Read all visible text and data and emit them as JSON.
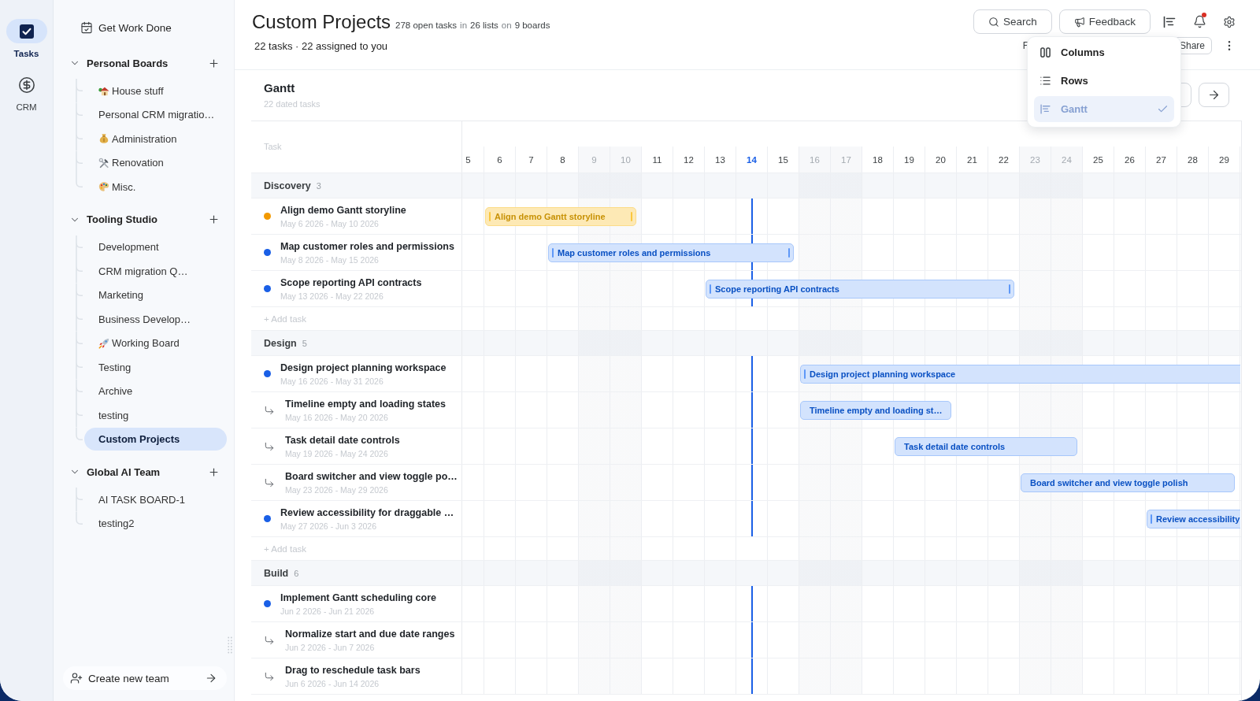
{
  "rail": [
    {
      "label": "Tasks",
      "kind": "tasks",
      "selected": true
    },
    {
      "label": "CRM",
      "kind": "crm",
      "selected": false
    }
  ],
  "sidebar": {
    "top_link": "Get Work Done",
    "sections": [
      {
        "title": "Personal Boards",
        "expanded": true,
        "items": [
          {
            "label": "House stuff",
            "kind": "house",
            "selected": false
          },
          {
            "label": "Personal CRM migratio…",
            "kind": "plain",
            "selected": false
          },
          {
            "label": "Administration",
            "kind": "moneybag",
            "selected": false
          },
          {
            "label": "Renovation",
            "kind": "tools",
            "selected": false
          },
          {
            "label": "Misc.",
            "kind": "palette",
            "selected": false
          }
        ]
      },
      {
        "title": "Tooling Studio",
        "expanded": true,
        "items": [
          {
            "label": "Development",
            "kind": "plain",
            "selected": false
          },
          {
            "label": "CRM migration Q…",
            "kind": "plain",
            "selected": false
          },
          {
            "label": "Marketing",
            "kind": "plain",
            "selected": false
          },
          {
            "label": "Business Develop…",
            "kind": "plain",
            "selected": false
          },
          {
            "label": "Working Board",
            "kind": "rocket",
            "selected": false
          },
          {
            "label": "Testing",
            "kind": "plain",
            "selected": false
          },
          {
            "label": "Archive",
            "kind": "plain",
            "selected": false
          },
          {
            "label": "testing",
            "kind": "plain",
            "selected": false
          },
          {
            "label": "Custom Projects",
            "kind": "plain",
            "selected": true
          }
        ]
      },
      {
        "title": "Global AI Team",
        "expanded": true,
        "items": [
          {
            "label": "AI TASK BOARD-1",
            "kind": "plain",
            "selected": false
          },
          {
            "label": "testing2",
            "kind": "plain",
            "selected": false
          }
        ]
      }
    ],
    "footer": "Create new team"
  },
  "header": {
    "title": "Custom Projects",
    "stats": [
      {
        "text": "278 open tasks",
        "kind": "value"
      },
      {
        "text": "in",
        "kind": "joiner"
      },
      {
        "text": "26 lists",
        "kind": "value"
      },
      {
        "text": "on",
        "kind": "joiner"
      },
      {
        "text": "9 boards",
        "kind": "value"
      }
    ],
    "subtitle": "22 tasks · 22 assigned to you",
    "buttons": [
      {
        "label": "Search",
        "kind": "search"
      },
      {
        "label": "Feedback",
        "kind": "feedback"
      }
    ],
    "notifications_unread": true,
    "covered_label": "F",
    "share_button": "Share"
  },
  "view_menu": [
    {
      "label": "Columns",
      "kind": "columns",
      "selected": false
    },
    {
      "label": "Rows",
      "kind": "rows",
      "selected": false
    },
    {
      "label": "Gantt",
      "kind": "gantt",
      "selected": true
    }
  ],
  "gantt": {
    "title": "Gantt",
    "subtitle": "22 dated tasks",
    "task_heading": "Task",
    "days": [
      {
        "label": "5",
        "weekend": false,
        "today": false
      },
      {
        "label": "6",
        "weekend": false,
        "today": false
      },
      {
        "label": "7",
        "weekend": false,
        "today": false
      },
      {
        "label": "8",
        "weekend": false,
        "today": false
      },
      {
        "label": "9",
        "weekend": true,
        "today": false
      },
      {
        "label": "10",
        "weekend": true,
        "today": false
      },
      {
        "label": "11",
        "weekend": false,
        "today": false
      },
      {
        "label": "12",
        "weekend": false,
        "today": false
      },
      {
        "label": "13",
        "weekend": false,
        "today": false
      },
      {
        "label": "14",
        "weekend": false,
        "today": true
      },
      {
        "label": "15",
        "weekend": false,
        "today": false
      },
      {
        "label": "16",
        "weekend": true,
        "today": false
      },
      {
        "label": "17",
        "weekend": true,
        "today": false
      },
      {
        "label": "18",
        "weekend": false,
        "today": false
      },
      {
        "label": "19",
        "weekend": false,
        "today": false
      },
      {
        "label": "20",
        "weekend": false,
        "today": false
      },
      {
        "label": "21",
        "weekend": false,
        "today": false
      },
      {
        "label": "22",
        "weekend": false,
        "today": false
      },
      {
        "label": "23",
        "weekend": true,
        "today": false
      },
      {
        "label": "24",
        "weekend": true,
        "today": false
      },
      {
        "label": "25",
        "weekend": false,
        "today": false
      },
      {
        "label": "26",
        "weekend": false,
        "today": false
      },
      {
        "label": "27",
        "weekend": false,
        "today": false
      },
      {
        "label": "28",
        "weekend": false,
        "today": false
      },
      {
        "label": "29",
        "weekend": false,
        "today": false
      }
    ],
    "groups": [
      {
        "name": "Discovery",
        "count": "3",
        "add_task": "+ Add task",
        "tasks": [
          {
            "kind": "task",
            "color": "#f29900",
            "title": "Align demo Gantt storyline",
            "dates": "May 6 2026 - May 10 2026",
            "bar": {
              "label": "Align demo Gantt storyline",
              "color": "#fde9b5",
              "handles": true
            }
          },
          {
            "kind": "task",
            "color": "#1a5fe6",
            "title": "Map customer roles and permissions",
            "dates": "May 8 2026 - May 15 2026",
            "bar": {
              "label": "Map customer roles and permissions",
              "color": "#d3e3fd",
              "handles": true
            }
          },
          {
            "kind": "task",
            "color": "#1a5fe6",
            "title": "Scope reporting API contracts",
            "dates": "May 13 2026 - May 22 2026",
            "bar": {
              "label": "Scope reporting API contracts",
              "color": "#d3e3fd",
              "handles": true
            }
          }
        ]
      },
      {
        "name": "Design",
        "count": "5",
        "add_task": "+ Add task",
        "tasks": [
          {
            "kind": "task",
            "color": "#1a5fe6",
            "title": "Design project planning workspace",
            "dates": "May 16 2026 - May 31 2026",
            "bar": {
              "label": "Design project planning workspace",
              "color": "#d3e3fd",
              "handles": true
            }
          },
          {
            "kind": "subtask",
            "title": "Timeline empty and loading states",
            "dates": "May 16 2026 - May 20 2026",
            "bar": {
              "label": "Timeline empty and loading st…",
              "color": "#d3e3fd",
              "handles": false
            }
          },
          {
            "kind": "subtask",
            "title": "Task detail date controls",
            "dates": "May 19 2026 - May 24 2026",
            "bar": {
              "label": "Task detail date controls",
              "color": "#d3e3fd",
              "handles": false
            }
          },
          {
            "kind": "subtask",
            "title": "Board switcher and view toggle po…",
            "dates": "May 23 2026 - May 29 2026",
            "bar": {
              "label": "Board switcher and view toggle polish",
              "color": "#d3e3fd",
              "handles": false
            }
          },
          {
            "kind": "task",
            "color": "#1a5fe6",
            "title": "Review accessibility for draggable …",
            "dates": "May 27 2026 - Jun 3 2026",
            "bar": {
              "label": "Review accessibility",
              "color": "#d3e3fd",
              "handles": true
            }
          }
        ]
      },
      {
        "name": "Build",
        "count": "6",
        "tasks": [
          {
            "kind": "task",
            "color": "#1a5fe6",
            "title": "Implement Gantt scheduling core",
            "dates": "Jun 2 2026 - Jun 21 2026"
          },
          {
            "kind": "subtask",
            "title": "Normalize start and due date ranges",
            "dates": "Jun 2 2026 - Jun 7 2026"
          },
          {
            "kind": "subtask",
            "title": "Drag to reschedule task bars",
            "dates": "Jun 6 2026 - Jun 14 2026"
          }
        ]
      }
    ]
  }
}
